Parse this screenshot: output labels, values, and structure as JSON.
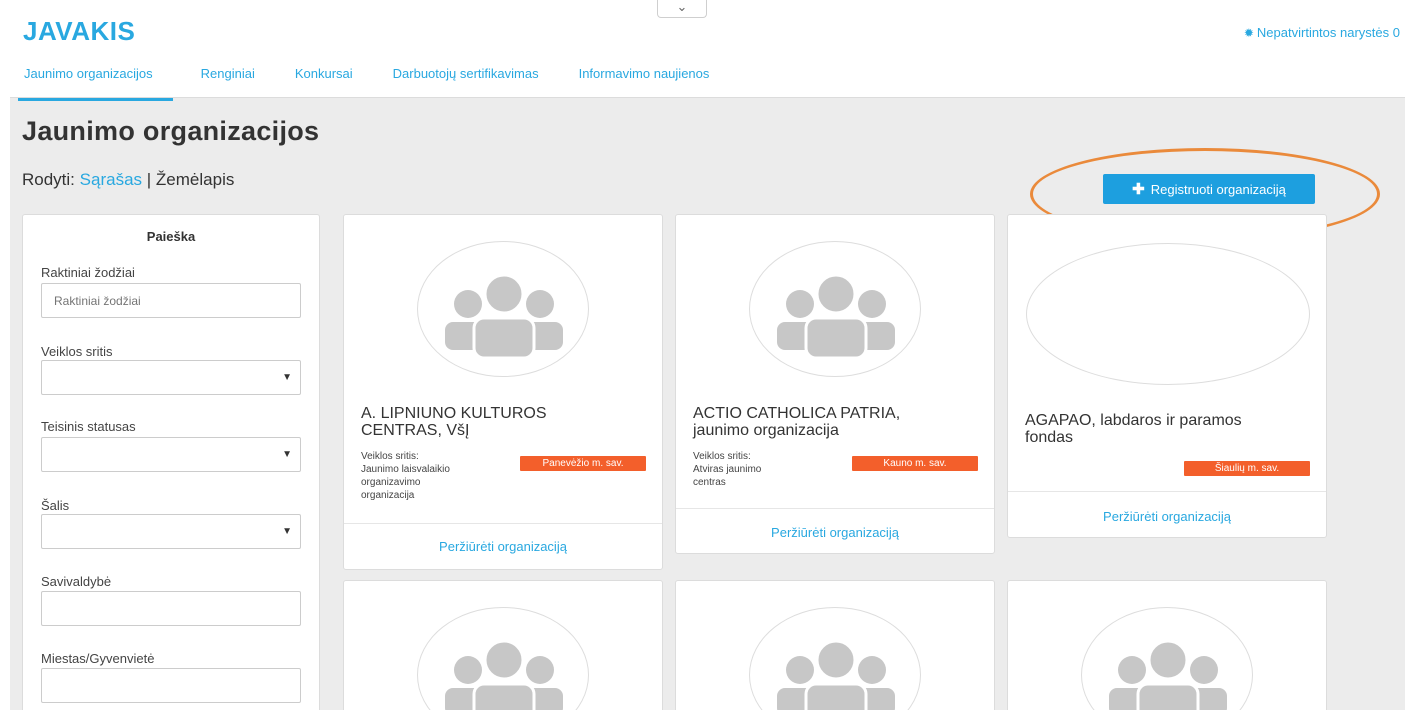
{
  "app": {
    "brand": "JAVAKIS",
    "membership_label": "Nepatvirtintos narystės 0"
  },
  "nav": {
    "items": [
      {
        "label": "Jaunimo organizacijos",
        "active": true
      },
      {
        "label": "Renginiai"
      },
      {
        "label": "Konkursai"
      },
      {
        "label": "Darbuotojų sertifikavimas"
      },
      {
        "label": "Informavimo naujienos"
      }
    ]
  },
  "page": {
    "title": "Jaunimo organizacijos",
    "view_prefix": "Rodyti:",
    "view_list": "Sąrašas",
    "view_separator": "|",
    "view_map": "Žemėlapis",
    "register_button": "Registruoti organizaciją"
  },
  "search": {
    "title": "Paieška",
    "keywords_label": "Raktiniai žodžiai",
    "keywords_placeholder": "Raktiniai žodžiai",
    "activity_label": "Veiklos sritis",
    "legal_status_label": "Teisinis statusas",
    "country_label": "Šalis",
    "municipality_label": "Savivaldybė",
    "city_label": "Miestas/Gyvenvietė"
  },
  "cards": [
    {
      "name_line1": "A. LIPNIUNO KULTUROS",
      "name_line2": "CENTRAS, VšĮ",
      "sphere_label": "Veiklos sritis:",
      "sphere_value_1": "Jaunimo laisvalaikio",
      "sphere_value_2": "organizavimo",
      "sphere_value_3": "organizacija",
      "municipality": "Panevėžio m. sav.",
      "link": "Peržiūrėti organizaciją"
    },
    {
      "name_line1": "ACTIO CATHOLICA PATRIA,",
      "name_line2": "jaunimo organizacija",
      "sphere_label": "Veiklos sritis:",
      "sphere_value_1": "Atviras jaunimo",
      "sphere_value_2": "centras",
      "municipality": "Kauno m. sav.",
      "link": "Peržiūrėti organizaciją"
    },
    {
      "name_line1": "AGAPAO, labdaros ir paramos",
      "name_line2": "fondas",
      "municipality": "Šiaulių m. sav.",
      "link": "Peržiūrėti organizaciją"
    }
  ],
  "icons": {
    "avatar": "group-placeholder-icon",
    "membership": "gear-icon",
    "caret": "caret-down-icon",
    "plus": "plus-icon",
    "collapse": "chevron-down-icon"
  },
  "colors": {
    "brand": "#29a8e0",
    "button": "#1d9fdf",
    "badge": "#f35f2b",
    "annotation": "#ea8a3b"
  }
}
